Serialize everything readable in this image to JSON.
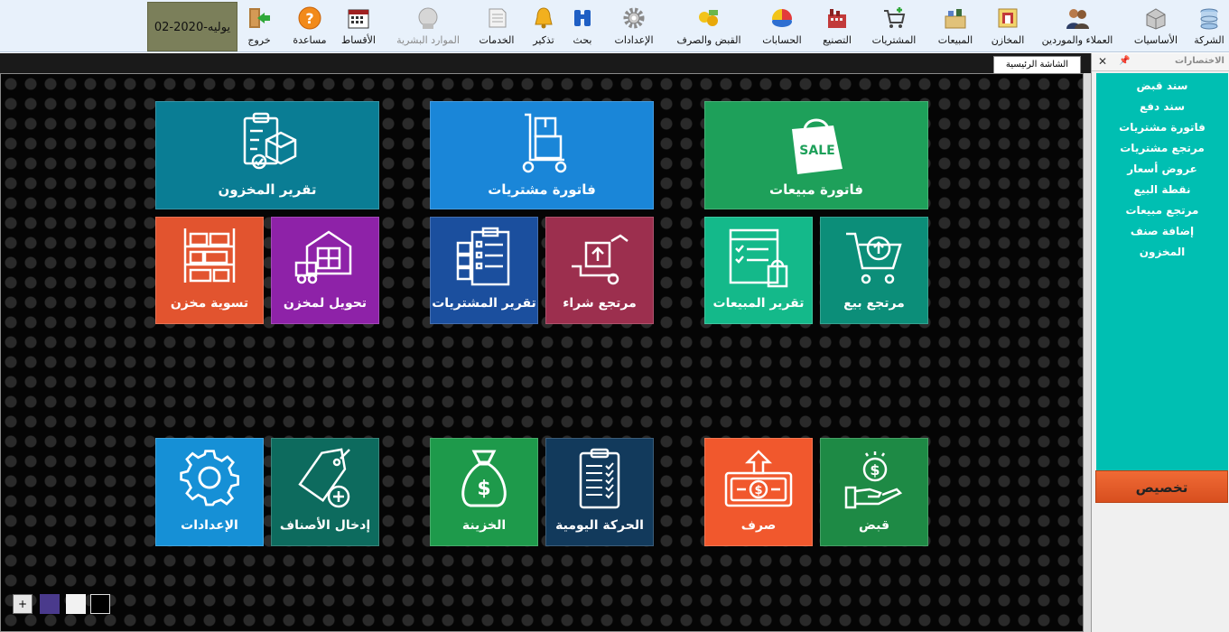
{
  "toolbar": {
    "date": "02-يوليه-2020",
    "items": [
      {
        "id": "company",
        "label": "الشركة",
        "icon": "company-icon"
      },
      {
        "id": "basics",
        "label": "الأساسيات",
        "icon": "basics-icon"
      },
      {
        "id": "customers",
        "label": "العملاء والموردين",
        "icon": "customers-icon"
      },
      {
        "id": "stores",
        "label": "المخازن",
        "icon": "stores-icon"
      },
      {
        "id": "sales",
        "label": "المبيعات",
        "icon": "sales-icon"
      },
      {
        "id": "purchases",
        "label": "المشتريات",
        "icon": "purchases-icon"
      },
      {
        "id": "manufacturing",
        "label": "التصنيع",
        "icon": "manufacturing-icon"
      },
      {
        "id": "accounts",
        "label": "الحسابات",
        "icon": "accounts-icon"
      },
      {
        "id": "cash",
        "label": "القبض والصرف",
        "icon": "cash-icon"
      },
      {
        "id": "settings",
        "label": "الإعدادات",
        "icon": "gear-icon"
      },
      {
        "id": "search",
        "label": "بحث",
        "icon": "binoculars-icon"
      },
      {
        "id": "reminder",
        "label": "تذكير",
        "icon": "bell-icon"
      },
      {
        "id": "services",
        "label": "الخدمات",
        "icon": "services-icon"
      },
      {
        "id": "hr",
        "label": "الموارد البشرية",
        "icon": "hr-icon",
        "disabled": true
      },
      {
        "id": "installments",
        "label": "الأقساط",
        "icon": "calendar-icon"
      },
      {
        "id": "help",
        "label": "مساعدة",
        "icon": "help-icon"
      },
      {
        "id": "exit",
        "label": "خروج",
        "icon": "exit-icon"
      }
    ]
  },
  "tabs": {
    "main": "الشاشة الرئيسية"
  },
  "tiles": {
    "inventory_report": "تقرير المخزون",
    "purchase_invoice": "فاتورة مشتريات",
    "sales_invoice": "فاتورة مبيعات",
    "sale_badge": "SALE",
    "store_settlement": "تسوية مخزن",
    "store_transfer": "تحويل لمخزن",
    "purchases_report": "تقرير المشتريات",
    "purchase_return": "مرتجع شراء",
    "sales_report": "تقرير المبيعات",
    "sale_return": "مرتجع بيع",
    "settings": "الإعدادات",
    "add_items": "إدخال الأصناف",
    "treasury": "الخزينة",
    "daily_movement": "الحركة اليومية",
    "payment": "صرف",
    "receipt": "قبض"
  },
  "colors": {
    "inventory_report": "#0a7d94",
    "purchase_invoice": "#1a86d8",
    "sales_invoice": "#1ea05a",
    "store_settlement": "#e2542f",
    "store_transfer": "#8e22a8",
    "purchases_report": "#1b4f9e",
    "purchase_return": "#9c2f4e",
    "sales_report": "#14b98a",
    "sale_return": "#0c8e79",
    "settings": "#1690d6",
    "add_items": "#0d6b5e",
    "treasury": "#1e9a4b",
    "daily_movement": "#123a5c",
    "payment": "#f1582d",
    "receipt": "#1e8a45"
  },
  "shortcuts": {
    "title": "الاختصارات",
    "items": [
      "سند قبض",
      "سند دفع",
      "فاتورة مشتريات",
      "مرتجع مشتريات",
      "عروض أسعار",
      "نقطة البيع",
      "مرتجع مبيعات",
      "إضافة صنف",
      "المخزون"
    ],
    "customize": "تخصيص"
  },
  "bottom": {
    "add_label": "+"
  }
}
